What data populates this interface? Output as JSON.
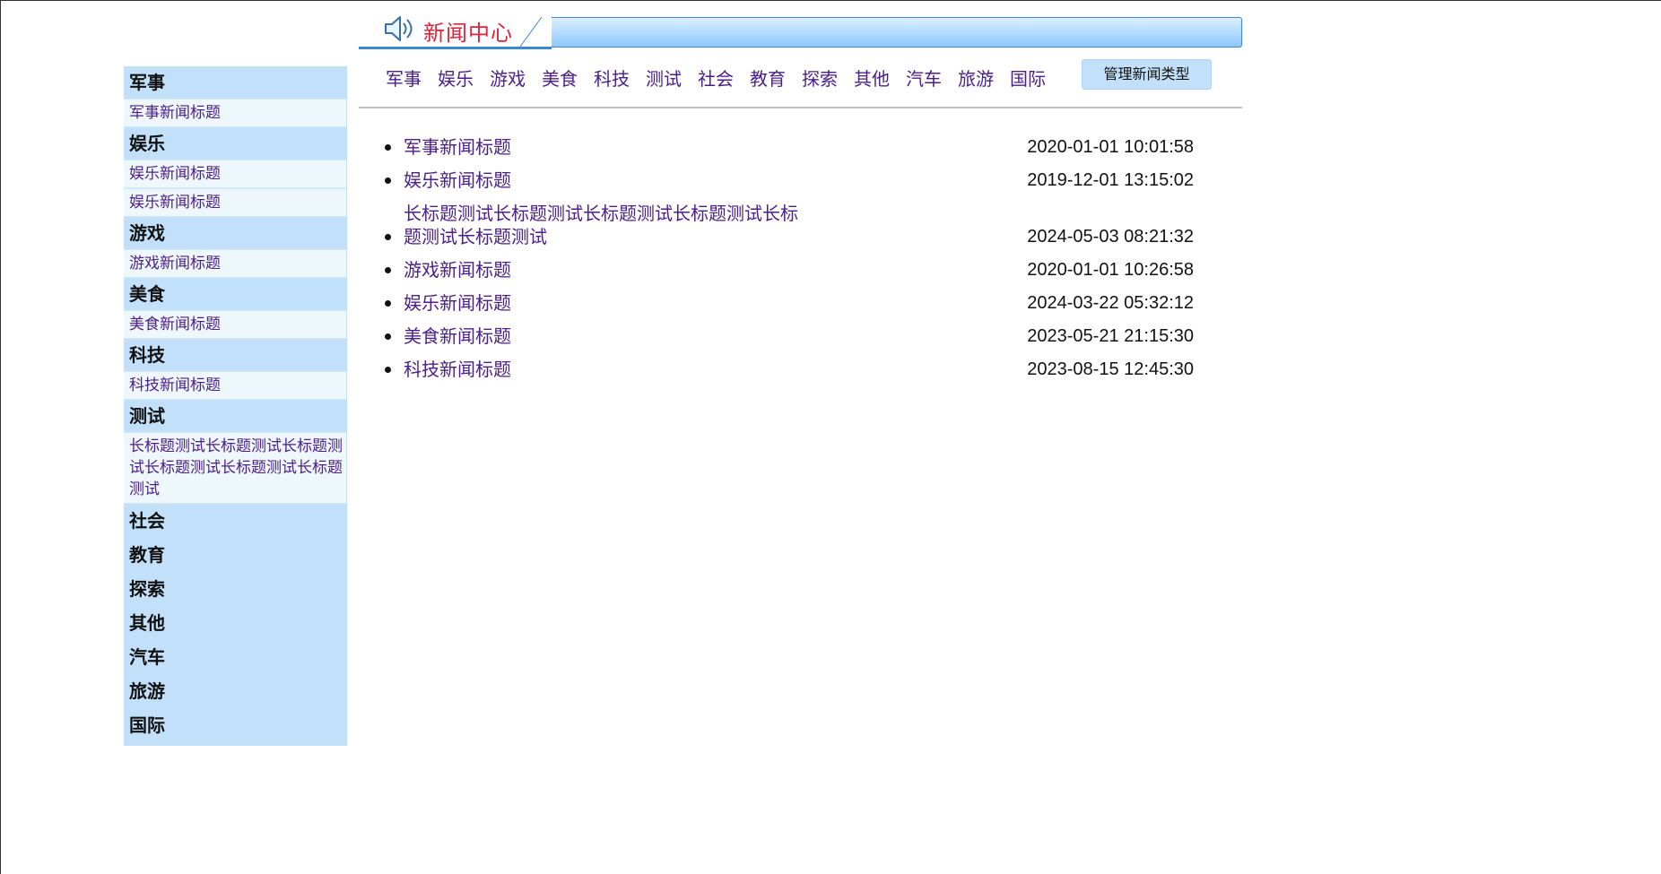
{
  "header": {
    "title": "新闻中心",
    "icon": "speaker-icon"
  },
  "sidebar": {
    "groups": [
      {
        "name": "军事",
        "items": [
          "军事新闻标题"
        ]
      },
      {
        "name": "娱乐",
        "items": [
          "娱乐新闻标题",
          "娱乐新闻标题"
        ]
      },
      {
        "name": "游戏",
        "items": [
          "游戏新闻标题"
        ]
      },
      {
        "name": "美食",
        "items": [
          "美食新闻标题"
        ]
      },
      {
        "name": "科技",
        "items": [
          "科技新闻标题"
        ]
      },
      {
        "name": "测试",
        "items": [
          "长标题测试长标题测试长标题测试长标题测试长标题测试长标题测试"
        ]
      },
      {
        "name": "社会",
        "items": []
      },
      {
        "name": "教育",
        "items": []
      },
      {
        "name": "探索",
        "items": []
      },
      {
        "name": "其他",
        "items": []
      },
      {
        "name": "汽车",
        "items": []
      },
      {
        "name": "旅游",
        "items": []
      },
      {
        "name": "国际",
        "items": []
      }
    ]
  },
  "nav": {
    "items": [
      "军事",
      "娱乐",
      "游戏",
      "美食",
      "科技",
      "测试",
      "社会",
      "教育",
      "探索",
      "其他",
      "汽车",
      "旅游",
      "国际"
    ],
    "manage_label": "管理新闻类型"
  },
  "news": [
    {
      "title": "军事新闻标题",
      "time": "2020-01-01 10:01:58"
    },
    {
      "title": "娱乐新闻标题",
      "time": "2019-12-01 13:15:02"
    },
    {
      "title": "长标题测试长标题测试长标题测试长标题测试长标题测试长标题测试",
      "time": "2024-05-03 08:21:32"
    },
    {
      "title": "游戏新闻标题",
      "time": "2020-01-01 10:26:58"
    },
    {
      "title": "娱乐新闻标题",
      "time": "2024-03-22 05:32:12"
    },
    {
      "title": "美食新闻标题",
      "time": "2023-05-21 21:15:30"
    },
    {
      "title": "科技新闻标题",
      "time": "2023-08-15 12:45:30"
    }
  ],
  "colors": {
    "accent": "#3a86d8",
    "sidebar_bg": "#c2e0fa",
    "link": "#4b1e8a",
    "title_red": "#e0223a"
  }
}
